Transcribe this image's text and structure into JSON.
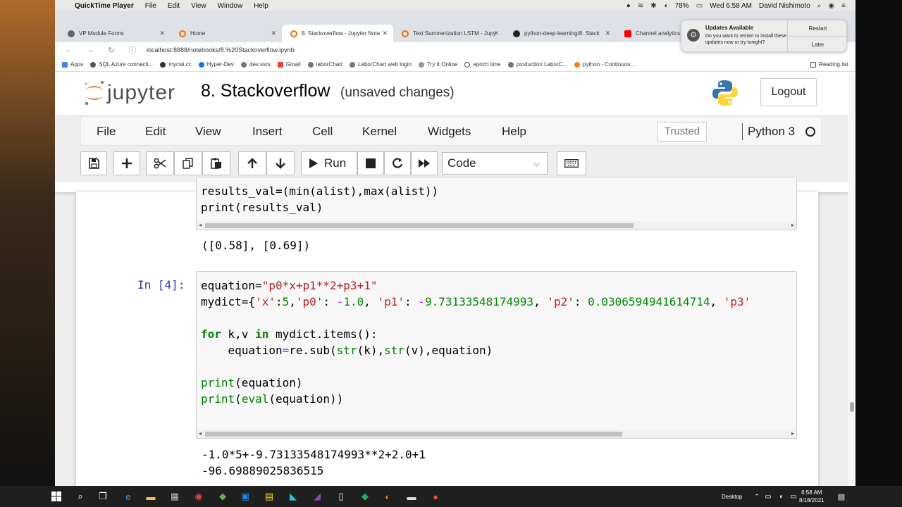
{
  "macbar": {
    "app": "QuickTime Player",
    "menus": [
      "File",
      "Edit",
      "View",
      "Window",
      "Help"
    ],
    "battery": "78%",
    "clock": "Wed 6:58 AM",
    "user": "David Nishimoto"
  },
  "browser": {
    "tabs": [
      {
        "label": "VP Module Forms",
        "color": "#5f6368"
      },
      {
        "label": "Home",
        "color": "#e8710a"
      },
      {
        "label": "8. Stackoverflow - Jupyter Note",
        "color": "#e8710a"
      },
      {
        "label": "Text Summerization LSTM - Jupy",
        "color": "#e8710a"
      },
      {
        "label": "python-deep-learning/8. Stack",
        "color": "#222222"
      },
      {
        "label": "Channel analytics",
        "color": "#ff0000"
      }
    ],
    "url": "localhost:8888/notebooks/8.%20Stackoverflow.ipynb",
    "bookmarks": [
      "Apps",
      "SQL Azure connecti...",
      "mycwi.cc",
      "Hyper-Dev",
      "dev ssrs",
      "Gmail",
      "laborChart",
      "LaborChart web login",
      "Try It Online",
      "epoch time",
      "production LaborC...",
      "python - Continuou..."
    ],
    "reading_list": "Reading list"
  },
  "notification": {
    "title": "Updates Available",
    "message": "Do you want to restart to install these updates now or try tonight?",
    "restart": "Restart",
    "later": "Later"
  },
  "jupyter": {
    "logo_text": "jupyter",
    "notebook_name": "8. Stackoverflow",
    "save_status": "(unsaved changes)",
    "logout": "Logout",
    "menu": [
      "File",
      "Edit",
      "View",
      "Insert",
      "Cell",
      "Kernel",
      "Widgets",
      "Help"
    ],
    "trusted": "Trusted",
    "kernel": "Python 3",
    "run_label": "Run",
    "cell_type": "Code"
  },
  "cells": {
    "cell1_lines": [
      "results_val=(min(alist),max(alist))",
      "print(results_val)"
    ],
    "cell1_output": "([0.58], [0.69])",
    "cell2_prompt": "In [4]:",
    "cell2_output": [
      "-1.0*5+-9.73133548174993**2+2.0+1",
      "-96.69889025836515"
    ]
  },
  "taskbar": {
    "desktop": "Desktop",
    "time": "6:58 AM",
    "date": "8/18/2021"
  }
}
